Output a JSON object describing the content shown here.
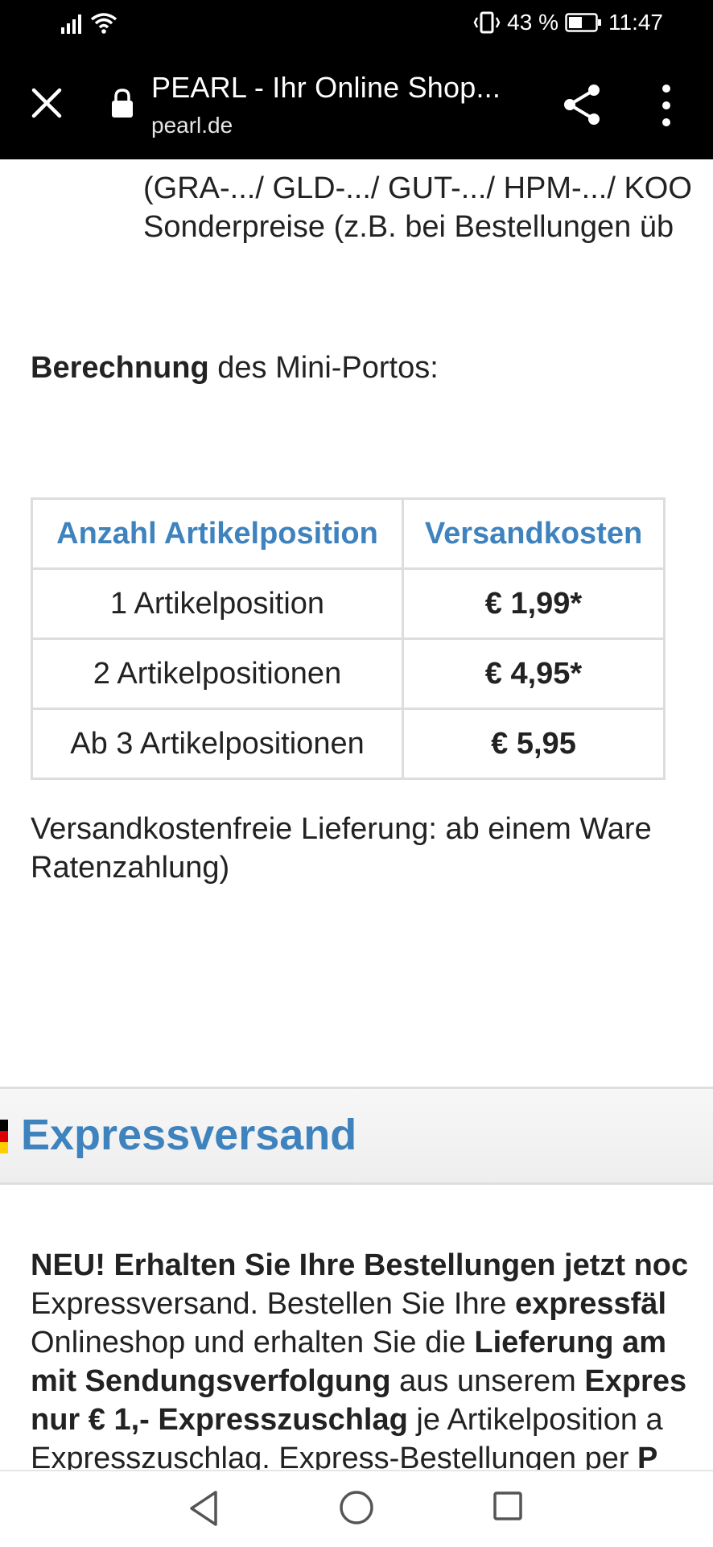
{
  "status_bar": {
    "battery_percent": "43 %",
    "time": "11:47"
  },
  "toolbar": {
    "title": "PEARL - Ihr Online Shop...",
    "url": "pearl.de"
  },
  "page": {
    "top_lines": [
      "(GRA-.../ GLD-.../ GUT-.../ HPM-.../ KOO",
      "Sonderpreise (z.B. bei Bestellungen üb"
    ],
    "calc_bold": "Berechnung",
    "calc_rest": " des Mini-Portos:",
    "table": {
      "headers": [
        "Anzahl Artikelposition",
        "Versandkosten"
      ],
      "rows": [
        {
          "label": "1 Artikelposition",
          "price": "€ 1,99*"
        },
        {
          "label": "2 Artikelpositionen",
          "price": "€ 4,95*"
        },
        {
          "label": "Ab 3 Artikelpositionen",
          "price": "€ 5,95"
        }
      ]
    },
    "free_shipping_lines": [
      "Versandkostenfreie Lieferung: ab einem Ware",
      "Ratenzahlung)"
    ],
    "express_title": "Expressversand",
    "express": {
      "l1_bold": "NEU! Erhalten Sie Ihre Bestellungen jetzt noc",
      "l2_a": "Expressversand. Bestellen Sie Ihre ",
      "l2_b": "expressfäl",
      "l3_a": "Onlineshop und erhalten Sie die ",
      "l3_b": "Lieferung am",
      "l4_b": "mit Sendungsverfolgung",
      "l4_a": " aus unserem ",
      "l4_c": "Expres",
      "l5_b": "nur € 1,- Expresszuschlag",
      "l5_a": " je Artikelposition a",
      "l6_a": "Expresszuschlag. Express-Bestellungen per ",
      "l6_b": "P"
    }
  },
  "colors": {
    "accent_blue": "#3e82be",
    "table_border": "#dddddd"
  }
}
